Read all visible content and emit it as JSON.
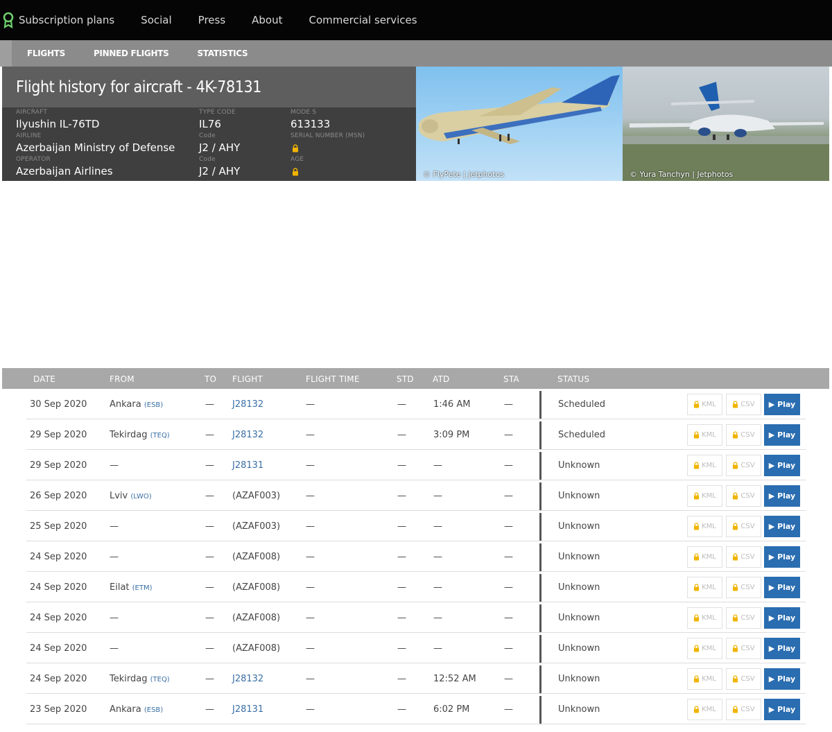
{
  "nav": {
    "items": [
      "Subscription plans",
      "Social",
      "Press",
      "About",
      "Commercial services"
    ]
  },
  "subnav": {
    "tabs": [
      "FLIGHTS",
      "PINNED FLIGHTS",
      "STATISTICS"
    ]
  },
  "aircraft": {
    "title": "Flight history for aircraft - 4K-78131",
    "labels": {
      "aircraft": "AIRCRAFT",
      "type_code": "TYPE CODE",
      "mode_s": "MODE S",
      "airline": "AIRLINE",
      "code1": "Code",
      "serial": "SERIAL NUMBER (MSN)",
      "operator": "OPERATOR",
      "code2": "Code",
      "age": "AGE"
    },
    "values": {
      "aircraft": "Ilyushin IL-76TD",
      "type_code": "IL76",
      "mode_s": "613133",
      "airline": "Azerbaijan Ministry of Defense",
      "airline_code": "J2 / AHY",
      "operator": "Azerbaijan Airlines",
      "operator_code": "J2 / AHY"
    }
  },
  "photos": {
    "credit1": "© FlyPete | Jetphotos",
    "credit2": "© Yura Tanchyn | Jetphotos"
  },
  "table": {
    "headers": [
      "DATE",
      "FROM",
      "TO",
      "FLIGHT",
      "FLIGHT TIME",
      "STD",
      "ATD",
      "STA",
      "STATUS"
    ],
    "buttons": {
      "kml": "KML",
      "csv": "CSV",
      "play": "▶ Play"
    },
    "rows": [
      {
        "date": "30 Sep 2020",
        "from": "Ankara",
        "from_code": "(ESB)",
        "to": "—",
        "flight": "J28132",
        "flight_link": true,
        "flight_time": "—",
        "std": "—",
        "atd": "1:46 AM",
        "sta": "—",
        "status": "Scheduled"
      },
      {
        "date": "29 Sep 2020",
        "from": "Tekirdag",
        "from_code": "(TEQ)",
        "to": "—",
        "flight": "J28132",
        "flight_link": true,
        "flight_time": "—",
        "std": "—",
        "atd": "3:09 PM",
        "sta": "—",
        "status": "Scheduled"
      },
      {
        "date": "29 Sep 2020",
        "from": "—",
        "from_code": "",
        "to": "—",
        "flight": "J28131",
        "flight_link": true,
        "flight_time": "—",
        "std": "—",
        "atd": "—",
        "sta": "—",
        "status": "Unknown"
      },
      {
        "date": "26 Sep 2020",
        "from": "Lviv",
        "from_code": "(LWO)",
        "to": "—",
        "flight": "(AZAF003)",
        "flight_link": false,
        "flight_time": "—",
        "std": "—",
        "atd": "—",
        "sta": "—",
        "status": "Unknown"
      },
      {
        "date": "25 Sep 2020",
        "from": "—",
        "from_code": "",
        "to": "—",
        "flight": "(AZAF003)",
        "flight_link": false,
        "flight_time": "—",
        "std": "—",
        "atd": "—",
        "sta": "—",
        "status": "Unknown"
      },
      {
        "date": "24 Sep 2020",
        "from": "—",
        "from_code": "",
        "to": "—",
        "flight": "(AZAF008)",
        "flight_link": false,
        "flight_time": "—",
        "std": "—",
        "atd": "—",
        "sta": "—",
        "status": "Unknown"
      },
      {
        "date": "24 Sep 2020",
        "from": "Eilat",
        "from_code": "(ETM)",
        "to": "—",
        "flight": "(AZAF008)",
        "flight_link": false,
        "flight_time": "—",
        "std": "—",
        "atd": "—",
        "sta": "—",
        "status": "Unknown"
      },
      {
        "date": "24 Sep 2020",
        "from": "—",
        "from_code": "",
        "to": "—",
        "flight": "(AZAF008)",
        "flight_link": false,
        "flight_time": "—",
        "std": "—",
        "atd": "—",
        "sta": "—",
        "status": "Unknown"
      },
      {
        "date": "24 Sep 2020",
        "from": "—",
        "from_code": "",
        "to": "—",
        "flight": "(AZAF008)",
        "flight_link": false,
        "flight_time": "—",
        "std": "—",
        "atd": "—",
        "sta": "—",
        "status": "Unknown"
      },
      {
        "date": "24 Sep 2020",
        "from": "Tekirdag",
        "from_code": "(TEQ)",
        "to": "—",
        "flight": "J28132",
        "flight_link": true,
        "flight_time": "—",
        "std": "—",
        "atd": "12:52 AM",
        "sta": "—",
        "status": "Unknown"
      },
      {
        "date": "23 Sep 2020",
        "from": "Ankara",
        "from_code": "(ESB)",
        "to": "—",
        "flight": "J28131",
        "flight_link": true,
        "flight_time": "—",
        "std": "—",
        "atd": "6:02 PM",
        "sta": "—",
        "status": "Unknown"
      }
    ]
  },
  "colors": {
    "accent_link": "#3a6fa6",
    "play_button": "#2a6db0",
    "lock": "#f0b400",
    "logo": "#6fd06f"
  },
  "icons": {
    "logo": "award-ribbon-icon",
    "lock": "lock-icon",
    "play": "play-icon"
  }
}
